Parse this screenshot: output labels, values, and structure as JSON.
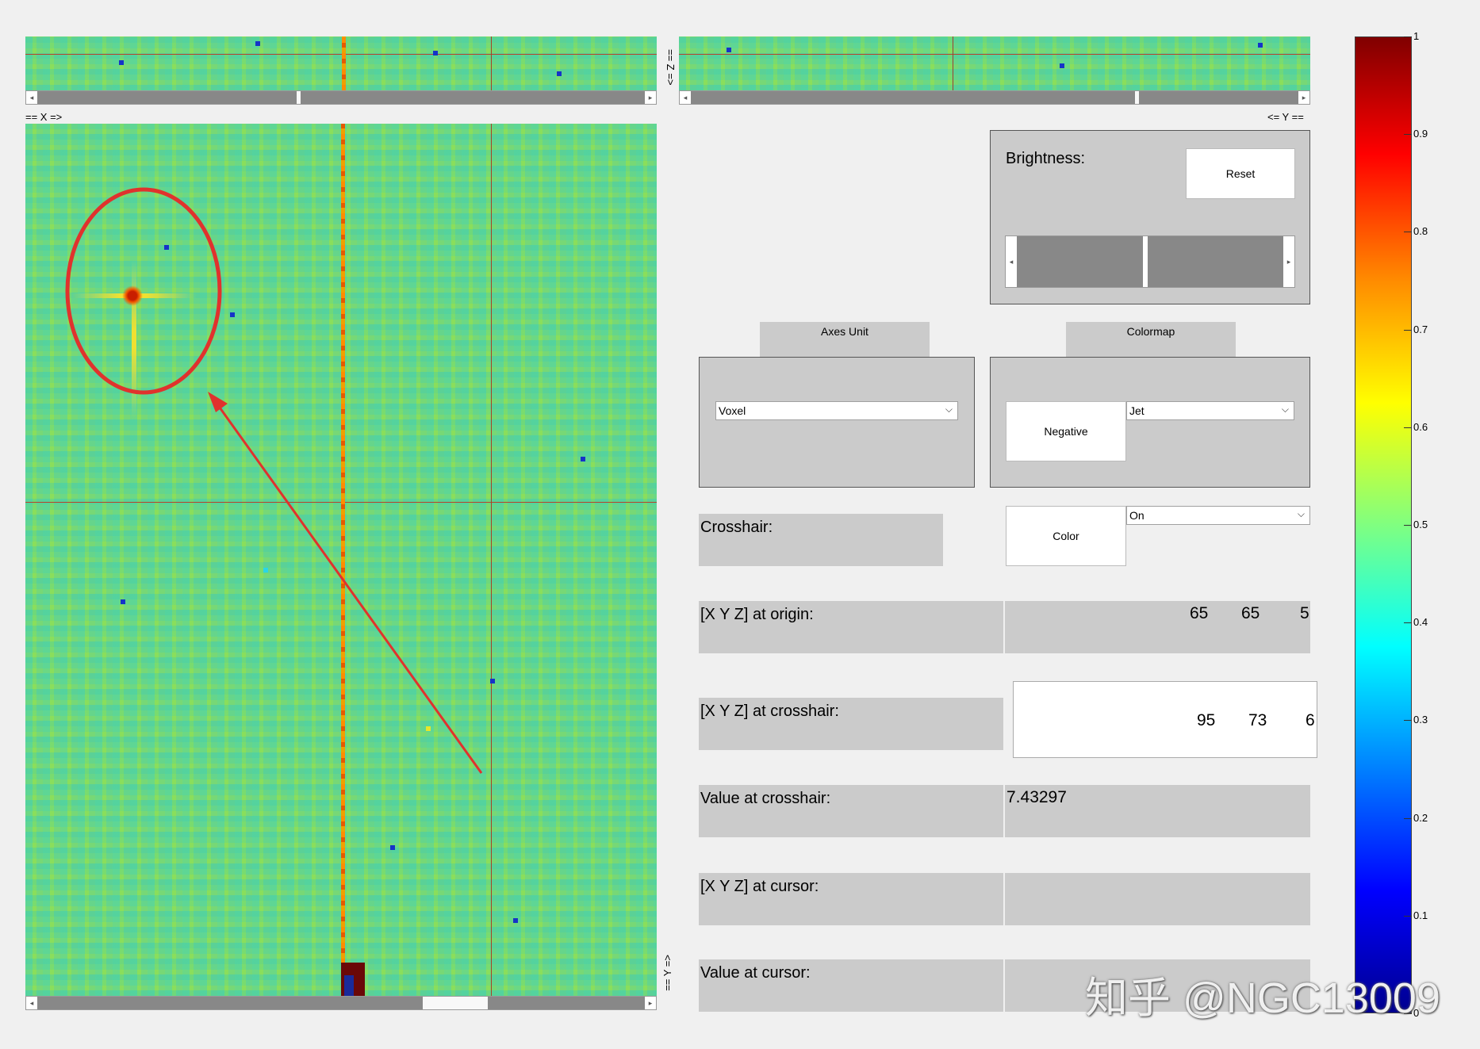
{
  "top_left_axis_label": "== X =>",
  "top_mid_axis_label": "== Z =>",
  "top_right_axis_label": "<= Y ==",
  "bottom_axis_label": "== Y =>",
  "brightness": {
    "label": "Brightness:",
    "reset_label": "Reset"
  },
  "axes_unit": {
    "tab_label": "Axes Unit",
    "selected": "Voxel"
  },
  "colormap": {
    "tab_label": "Colormap",
    "negative_label": "Negative",
    "selected": "Jet"
  },
  "crosshair": {
    "label": "Crosshair:",
    "color_label": "Color",
    "selected": "On"
  },
  "origin": {
    "label": "[X Y Z] at origin:",
    "x": "65",
    "y": "65",
    "z": "5"
  },
  "at_crosshair": {
    "label": "[X Y Z] at crosshair:",
    "x": "95",
    "y": "73",
    "z": "6"
  },
  "value_crosshair": {
    "label": "Value at crosshair:",
    "value": "7.43297"
  },
  "at_cursor": {
    "label": "[X Y Z] at cursor:",
    "value": ""
  },
  "value_cursor": {
    "label": "Value at cursor:",
    "value": ""
  },
  "colorbar": {
    "ticks": [
      "1",
      "0.9",
      "0.8",
      "0.7",
      "0.6",
      "0.5",
      "0.4",
      "0.3",
      "0.2",
      "0.1",
      "0"
    ]
  },
  "watermark": "知乎 @NGC13009",
  "colors": {
    "panel": "#cbcbcb",
    "crosshair": "#a64424",
    "annotation": "#e0322d"
  }
}
